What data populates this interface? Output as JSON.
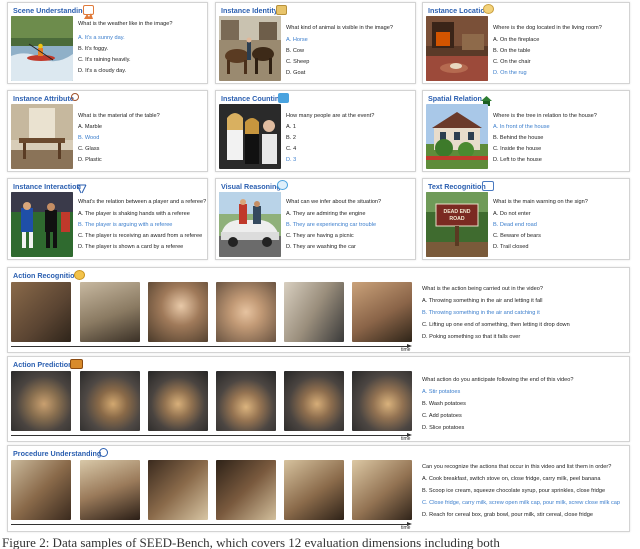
{
  "colors": {
    "title": "#2b5fb0",
    "correct": "#3a7dcc",
    "text": "#222222"
  },
  "panels": [
    {
      "title": "Scene Understanding",
      "icon": "landscape-icon",
      "question": "What is the weather like in the image?",
      "options": [
        "A. It's a sunny day.",
        "B. It's foggy.",
        "C. It's raining heavily.",
        "D. It's a cloudy day."
      ],
      "answer": 0
    },
    {
      "title": "Instance Identity",
      "icon": "id-card-icon",
      "question": "What kind of animal is visible in the image?",
      "options": [
        "A. Horse",
        "B. Cow",
        "C. Sheep",
        "D. Goat"
      ],
      "answer": 0
    },
    {
      "title": "Instance Location",
      "icon": "location-pin-icon",
      "question": "Where is the dog located in the living room?",
      "options": [
        "A. On the fireplace",
        "B. On the table",
        "C. On the chair",
        "D. On the rug"
      ],
      "answer": 3
    },
    {
      "title": "Instance Attribute",
      "icon": "magnifier-icon",
      "question": "What is the material of the table?",
      "options": [
        "A. Marble",
        "B. Wood",
        "C. Glass",
        "D. Plastic"
      ],
      "answer": 1
    },
    {
      "title": "Instance Counting",
      "icon": "counter-icon",
      "question": "How many people are at the event?",
      "options": [
        "A. 1",
        "B. 2",
        "C. 4",
        "D. 3"
      ],
      "answer": 3
    },
    {
      "title": "Spatial Relation",
      "icon": "house-tree-icon",
      "question": "Where is the tree in relation to the house?",
      "options": [
        "A. In front of the house",
        "B. Behind the house",
        "C. Inside the house",
        "D. Left to the house"
      ],
      "answer": 0
    },
    {
      "title": "Instance Interaction",
      "icon": "interaction-icon",
      "question": "What's the relation between a player and a referee?",
      "options": [
        "A. The player is shaking hands with a referee",
        "B. The player is arguing with a referee",
        "C. The player is receiving an award from a referee",
        "D. The player is shown a card by a referee"
      ],
      "answer": 1
    },
    {
      "title": "Visual Reasoning",
      "icon": "brain-icon",
      "question": "What can we infer about the situation?",
      "options": [
        "A. They are admiring the engine",
        "B. They are experiencing car trouble",
        "C. They are having a picnic",
        "D. They are washing the car"
      ],
      "answer": 1
    },
    {
      "title": "Text Recognition",
      "icon": "ocr-icon",
      "question": "What is the main warning on the sign?",
      "options": [
        "A. Do not enter",
        "B. Dead end road",
        "C. Beware of bears",
        "D. Trail closed"
      ],
      "answer": 1
    }
  ],
  "sign_text": [
    "DEAD END",
    "ROAD"
  ],
  "videos": [
    {
      "title": "Action Recognition",
      "icon": "running-person-icon",
      "question": "What is the action being carried out in the video?",
      "options": [
        "A. Throwing something in the air and letting it fall",
        "B. Throwing something in the air and catching it",
        "C. Lifting up one end of something, then letting it drop down",
        "D. Poking something so that it falls over"
      ],
      "answer": 1,
      "time_label": "time"
    },
    {
      "title": "Action Prediction",
      "icon": "film-icon",
      "question": "What action do you anticipate following the end of this video?",
      "options": [
        "A. Stir potatoes",
        "B. Wash potatoes",
        "C. Add potatoes",
        "D. Slice potatoes"
      ],
      "answer": 0,
      "time_label": "time"
    },
    {
      "title": "Procedure Understanding",
      "icon": "cycle-arrows-icon",
      "question": "Can you recognize the actions that occur in this video and list them in order?",
      "options": [
        "A. Cook breakfast, switch stove on, close fridge, carry milk, peel banana",
        "B. Scoop ice cream, squeeze chocolate syrup, pour sprinkles, close fridge",
        "C. Close fridge, carry milk, screw open milk cap, pour milk, screw close milk cap",
        "D. Reach for cereal box, grab bowl, pour milk, stir cereal, close fridge"
      ],
      "answer": 2,
      "time_label": "time"
    }
  ],
  "caption": "Figure 2: Data samples of SEED-Bench, which covers 12 evaluation dimensions including both"
}
